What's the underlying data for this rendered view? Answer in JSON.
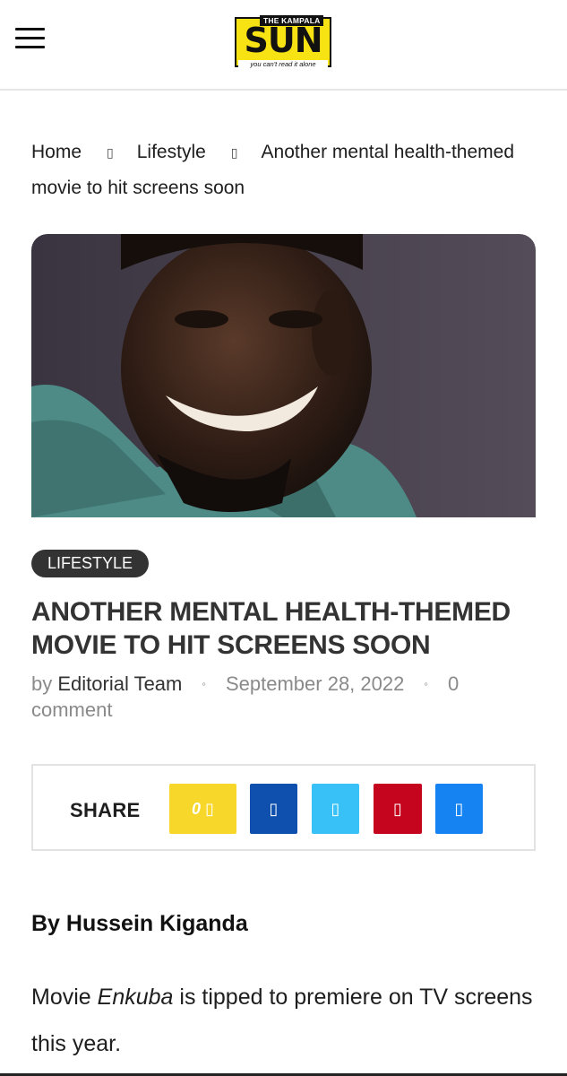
{
  "header": {
    "logo_top": "THE KAMPALA",
    "logo_main": "SUN",
    "logo_tagline": "you can't read it alone"
  },
  "breadcrumb": {
    "home": "Home",
    "sep1": "▯",
    "category": "Lifestyle",
    "sep2": "▯",
    "current": "Another mental health-themed movie to hit screens soon"
  },
  "article": {
    "category_badge": "LIFESTYLE",
    "title": "ANOTHER MENTAL HEALTH-THEMED MOVIE TO HIT SCREENS SOON",
    "meta": {
      "by": "by",
      "author": "Editorial Team",
      "dot1": "◦",
      "date": "September 28, 2022",
      "dot2": "◦",
      "comments": "0 comment"
    },
    "byline": "By Hussein Kiganda",
    "para_start": "Movie ",
    "para_em": "Enkuba",
    "para_end": " is tipped to premiere on TV screens this year."
  },
  "share": {
    "label": "SHARE",
    "count": "0",
    "count_glyph": "▯",
    "facebook_glyph": "▯",
    "twitter_glyph": "▯",
    "pinterest_glyph": "▯",
    "messenger_glyph": "▯"
  },
  "icons": {
    "menu": "hamburger-icon"
  },
  "colors": {
    "share_count": "#f6d72a",
    "facebook": "#0f4fae",
    "twitter": "#38c1f6",
    "pinterest": "#c5051e",
    "messenger": "#1583f2",
    "badge": "#333333",
    "logo_yellow": "#f7e214"
  }
}
